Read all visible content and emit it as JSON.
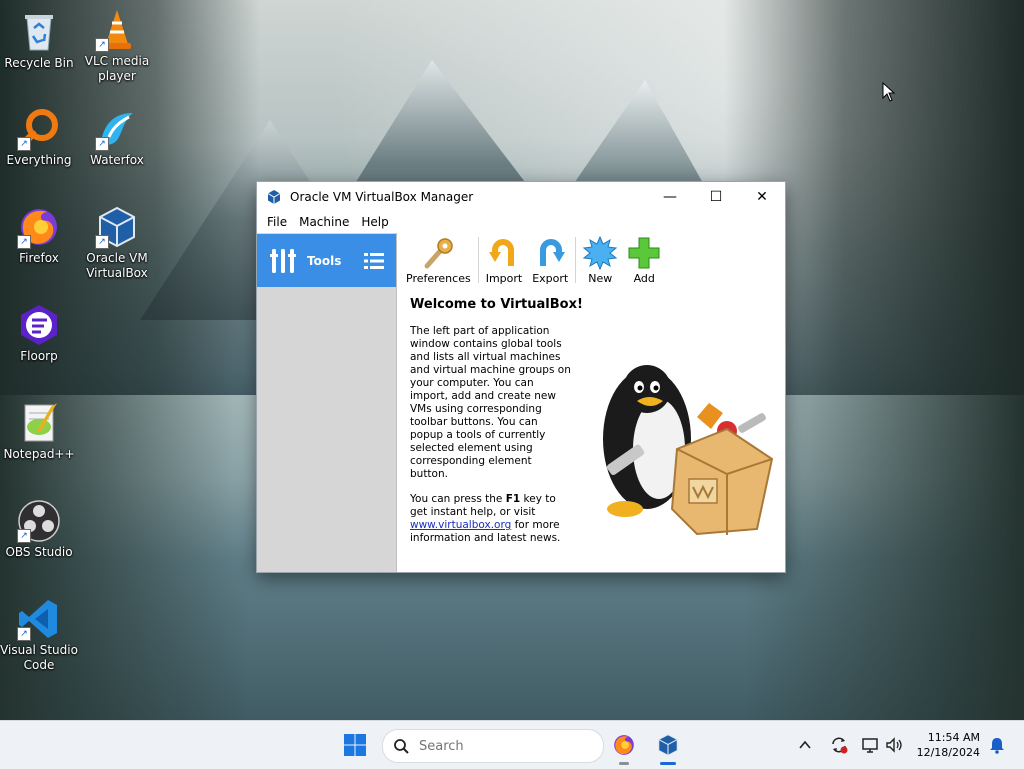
{
  "desktop": {
    "icons": [
      {
        "label": "Recycle Bin"
      },
      {
        "label": "VLC media player"
      },
      {
        "label": "Everything"
      },
      {
        "label": "Waterfox"
      },
      {
        "label": "Firefox"
      },
      {
        "label": "Oracle VM VirtualBox"
      },
      {
        "label": "Floorp"
      },
      {
        "label": "Notepad++"
      },
      {
        "label": "OBS Studio"
      },
      {
        "label": "Visual Studio Code"
      }
    ]
  },
  "window": {
    "title": "Oracle VM VirtualBox Manager",
    "controls": {
      "minimize": "—",
      "maximize": "☐",
      "close": "✕"
    },
    "menu": [
      "File",
      "Machine",
      "Help"
    ],
    "left_pane": {
      "tools_label": "Tools"
    },
    "toolbar": [
      {
        "label": "Preferences"
      },
      {
        "label": "Import"
      },
      {
        "label": "Export"
      },
      {
        "label": "New"
      },
      {
        "label": "Add"
      }
    ],
    "welcome": {
      "title": "Welcome to VirtualBox!",
      "para1": "The left part of application window contains global tools and lists all virtual machines and virtual machine groups on your computer. You can import, add and create new VMs using corresponding toolbar buttons. You can popup a tools of currently selected element using corresponding element button.",
      "para2_prefix": "You can press the ",
      "para2_key": "F1",
      "para2_mid": " key to get instant help, or visit ",
      "para2_link": "www.virtualbox.org",
      "para2_suffix": " for more information and latest news."
    }
  },
  "taskbar": {
    "search_placeholder": "Search",
    "time": "11:54 AM",
    "date": "12/18/2024"
  }
}
